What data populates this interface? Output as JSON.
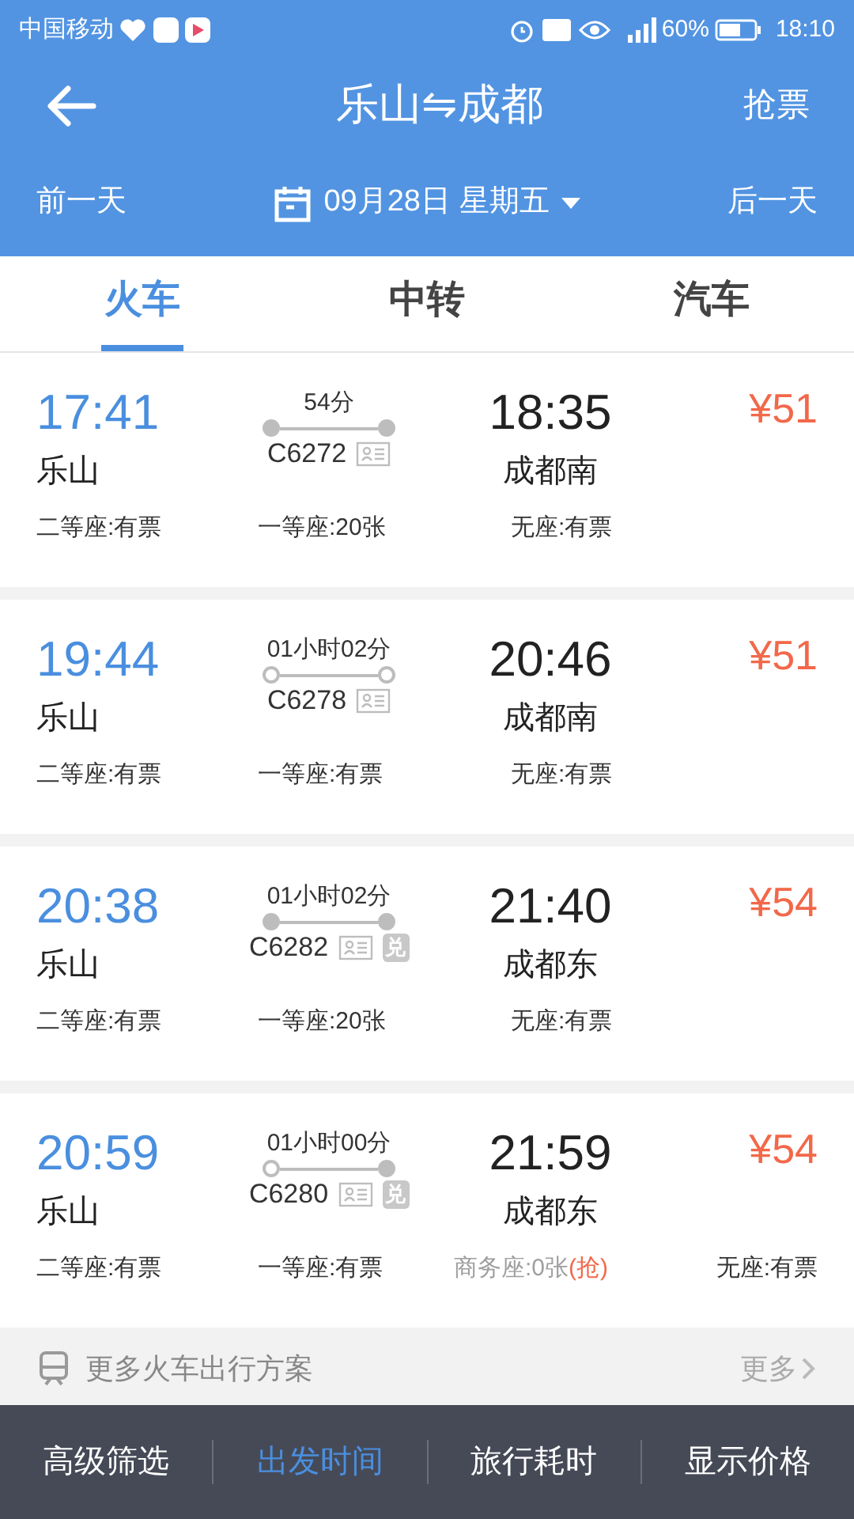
{
  "status_bar": {
    "carrier": "中国移动",
    "battery": "60%",
    "time": "18:10"
  },
  "header": {
    "title": "乐山⇋成都",
    "action": "抢票"
  },
  "date_bar": {
    "prev": "前一天",
    "date": "09月28日 星期五",
    "next": "后一天"
  },
  "tabs": [
    {
      "label": "火车",
      "selected": true
    },
    {
      "label": "中转",
      "selected": false
    },
    {
      "label": "汽车",
      "selected": false
    }
  ],
  "trains": [
    {
      "depart": "17:41",
      "from": "乐山",
      "duration": "54分",
      "number": "C6272",
      "start_filled": true,
      "end_filled": true,
      "arrive": "18:35",
      "to": "成都南",
      "price": "¥51",
      "seats": [
        {
          "text": "二等座:有票",
          "sold_out": false
        },
        {
          "text": "一等座:20张",
          "sold_out": false
        },
        {
          "text": "无座:有票",
          "sold_out": false
        }
      ]
    },
    {
      "depart": "19:44",
      "from": "乐山",
      "duration": "01小时02分",
      "number": "C6278",
      "start_filled": false,
      "end_filled": false,
      "arrive": "20:46",
      "to": "成都南",
      "price": "¥51",
      "seats": [
        {
          "text": "二等座:有票",
          "sold_out": false
        },
        {
          "text": "一等座:有票",
          "sold_out": false
        },
        {
          "text": "无座:有票",
          "sold_out": false
        }
      ]
    },
    {
      "depart": "20:38",
      "from": "乐山",
      "duration": "01小时02分",
      "number": "C6282",
      "exchange": "兑",
      "start_filled": true,
      "end_filled": true,
      "arrive": "21:40",
      "to": "成都东",
      "price": "¥54",
      "seats": [
        {
          "text": "二等座:有票",
          "sold_out": false
        },
        {
          "text": "一等座:20张",
          "sold_out": false
        },
        {
          "text": "无座:有票",
          "sold_out": false
        }
      ]
    },
    {
      "depart": "20:59",
      "from": "乐山",
      "duration": "01小时00分",
      "number": "C6280",
      "exchange": "兑",
      "start_filled": false,
      "end_filled": true,
      "arrive": "21:59",
      "to": "成都东",
      "price": "¥54",
      "seats": [
        {
          "text": "二等座:有票",
          "sold_out": false
        },
        {
          "text": "一等座:有票",
          "sold_out": false
        },
        {
          "text": "商务座:0张",
          "sold_out": true,
          "grab": "(抢)"
        },
        {
          "text": "无座:有票",
          "sold_out": false
        }
      ]
    }
  ],
  "more": {
    "label": "更多火车出行方案",
    "link": "更多"
  },
  "bottom_bar": [
    {
      "label": "高级筛选",
      "selected": false
    },
    {
      "label": "出发时间",
      "selected": true
    },
    {
      "label": "旅行耗时",
      "selected": false
    },
    {
      "label": "显示价格",
      "selected": false
    }
  ]
}
